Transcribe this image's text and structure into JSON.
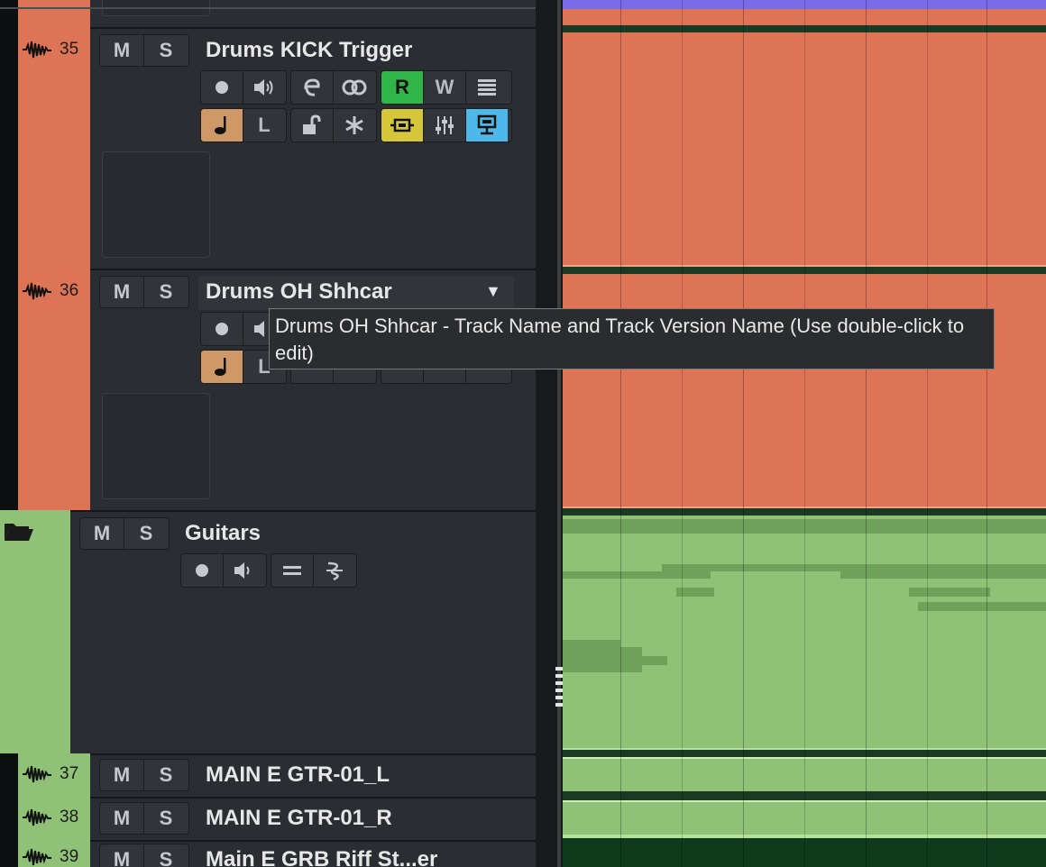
{
  "tracks": [
    {
      "number": "35",
      "name": "Drums KICK Trigger",
      "color": "#dd7456",
      "mute_label": "M",
      "solo_label": "S",
      "buttons_row1": {
        "r": "R",
        "w": "W"
      },
      "buttons_row2": {
        "l": "L"
      }
    },
    {
      "number": "36",
      "name": "Drums OH Shhcar",
      "color": "#dd7456",
      "mute_label": "M",
      "solo_label": "S",
      "buttons_row2": {
        "l": "L"
      }
    },
    {
      "name": "Guitars",
      "color": "#8fc277",
      "mute_label": "M",
      "solo_label": "S",
      "folder": true
    },
    {
      "number": "37",
      "name": "MAIN E GTR-01_L",
      "color": "#8fc277",
      "mute_label": "M",
      "solo_label": "S"
    },
    {
      "number": "38",
      "name": "MAIN E GTR-01_R",
      "color": "#8fc277",
      "mute_label": "M",
      "solo_label": "S"
    },
    {
      "number": "39",
      "name": "Main E GRB Riff St...er",
      "color": "#8fc277",
      "mute_label": "M",
      "solo_label": "S"
    }
  ],
  "tooltip": {
    "text": "Drums OH Shhcar - Track Name and Track Version Name (Use double-click to edit)"
  },
  "colors": {
    "drums": "#dd7456",
    "guitars": "#8fc277",
    "read_active": "#2fb548",
    "monitor_active": "#4fb8ea",
    "edit_in_place": "#d6c73a",
    "note_tempo": "#cf9967",
    "ruler": "#7b6be6"
  }
}
